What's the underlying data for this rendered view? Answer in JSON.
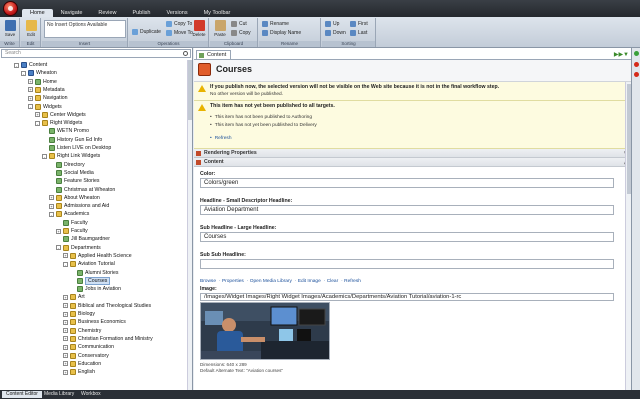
{
  "tabs": [
    "Home",
    "Navigate",
    "Review",
    "Publish",
    "Versions",
    "My Toolbar"
  ],
  "ribbon": {
    "save": "Save",
    "edit": "Edit",
    "insert_options": "No Insert Options Available",
    "duplicate": "Duplicate",
    "copy_to": "Copy To",
    "move_to": "Move To",
    "delete": "Delete",
    "paste": "Paste",
    "cut": "Cut",
    "copy": "Copy",
    "rename": "Rename",
    "display_name": "Display Name",
    "up": "Up",
    "down": "Down",
    "first": "First",
    "last": "Last",
    "groups": [
      "Write",
      "Edit",
      "Insert",
      "Operations",
      "Clipboard",
      "Rename",
      "Sorting"
    ]
  },
  "search": {
    "placeholder": "Search"
  },
  "tree": [
    {
      "label": "Content",
      "indent": 0,
      "icon": "db",
      "exp": "-"
    },
    {
      "label": "Wheaton",
      "indent": 1,
      "icon": "db",
      "exp": "-"
    },
    {
      "label": "Home",
      "indent": 2,
      "icon": "page",
      "exp": "+"
    },
    {
      "label": "Metadata",
      "indent": 2,
      "icon": "folder",
      "exp": "+"
    },
    {
      "label": "Navigation",
      "indent": 2,
      "icon": "folder",
      "exp": "+"
    },
    {
      "label": "Widgets",
      "indent": 2,
      "icon": "folder",
      "exp": "-"
    },
    {
      "label": "Center Widgets",
      "indent": 3,
      "icon": "folder",
      "exp": "+"
    },
    {
      "label": "Right Widgets",
      "indent": 3,
      "icon": "folder",
      "exp": "-"
    },
    {
      "label": "WETN Promo",
      "indent": 4,
      "icon": "page",
      "exp": ""
    },
    {
      "label": "History Gun Ed Info",
      "indent": 4,
      "icon": "page",
      "exp": ""
    },
    {
      "label": "Listen LIVE on Desktop",
      "indent": 4,
      "icon": "page",
      "exp": ""
    },
    {
      "label": "Right Link Widgets",
      "indent": 4,
      "icon": "folder",
      "exp": "-"
    },
    {
      "label": "Directory",
      "indent": 5,
      "icon": "page",
      "exp": ""
    },
    {
      "label": "Social Media",
      "indent": 5,
      "icon": "page",
      "exp": ""
    },
    {
      "label": "Feature Stories",
      "indent": 5,
      "icon": "page",
      "exp": ""
    },
    {
      "label": "Christmas at Wheaton",
      "indent": 5,
      "icon": "page",
      "exp": ""
    },
    {
      "label": "About Wheaton",
      "indent": 5,
      "icon": "folder",
      "exp": "+"
    },
    {
      "label": "Admissions and Aid",
      "indent": 5,
      "icon": "folder",
      "exp": "+"
    },
    {
      "label": "Academics",
      "indent": 5,
      "icon": "folder",
      "exp": "-"
    },
    {
      "label": "Faculty",
      "indent": 6,
      "icon": "page",
      "exp": ""
    },
    {
      "label": "Faculty",
      "indent": 6,
      "icon": "folder",
      "exp": "+"
    },
    {
      "label": "Jill Baumgardner",
      "indent": 6,
      "icon": "page",
      "exp": ""
    },
    {
      "label": "Departments",
      "indent": 6,
      "icon": "folder",
      "exp": "-"
    },
    {
      "label": "Applied Health Science",
      "indent": 7,
      "icon": "folder",
      "exp": "+"
    },
    {
      "label": "Aviation Tutorial",
      "indent": 7,
      "icon": "folder",
      "exp": "-"
    },
    {
      "label": "Alumni Stories",
      "indent": 8,
      "icon": "page",
      "exp": ""
    },
    {
      "label": "Courses",
      "indent": 8,
      "icon": "page",
      "exp": "",
      "selected": true
    },
    {
      "label": "Jobs in Aviation",
      "indent": 8,
      "icon": "page",
      "exp": ""
    },
    {
      "label": "Art",
      "indent": 7,
      "icon": "folder",
      "exp": "+"
    },
    {
      "label": "Biblical and Theological Studies",
      "indent": 7,
      "icon": "folder",
      "exp": "+"
    },
    {
      "label": "Biology",
      "indent": 7,
      "icon": "folder",
      "exp": "+"
    },
    {
      "label": "Business Economics",
      "indent": 7,
      "icon": "folder",
      "exp": "+"
    },
    {
      "label": "Chemistry",
      "indent": 7,
      "icon": "folder",
      "exp": "+"
    },
    {
      "label": "Christian Formation and Ministry",
      "indent": 7,
      "icon": "folder",
      "exp": "+"
    },
    {
      "label": "Communication",
      "indent": 7,
      "icon": "folder",
      "exp": "+"
    },
    {
      "label": "Conservatory",
      "indent": 7,
      "icon": "folder",
      "exp": "+"
    },
    {
      "label": "Education",
      "indent": 7,
      "icon": "folder",
      "exp": "+"
    },
    {
      "label": "English",
      "indent": 7,
      "icon": "folder",
      "exp": "+"
    }
  ],
  "content": {
    "tab_label": "Content",
    "title": "Courses",
    "warning1_title": "If you publish now, the selected version will not be visible on the Web site because it is not in the final workflow step.",
    "warning1_sub": "No other version will be published.",
    "warning2_title": "This item has not yet been published to all targets.",
    "bullets": [
      "This item has not been published to Authoring",
      "This item has not yet been published to Delivery"
    ],
    "refresh": "Refresh",
    "sections": {
      "rendering": "Rendering Properties",
      "content": "Content"
    },
    "fields": {
      "color_label": "Color:",
      "color_value": "Colors/green",
      "headline_label": "Headline - Small Descriptor Headline:",
      "headline_value": "Aviation Department",
      "sub_label": "Sub Headline - Large Headline:",
      "sub_value": "Courses",
      "subsub_label": "Sub Sub Headline:",
      "subsub_value": ""
    },
    "image_links": [
      "Browse",
      "Properties",
      "Open Media Library",
      "Edit Image",
      "Clear",
      "Refresh"
    ],
    "image_label": "Image:",
    "image_path": "/Images/Widget Images/Right Widget Images/Academics/Departments/Aviation Tutorial/aviation-1-rc",
    "image_dims": "Dimensions: 640 x 289",
    "image_alt": "Default Alternate Text: \"Aviation courses\""
  },
  "bottom_tabs": [
    "Content Editor",
    "Media Library",
    "Workbox"
  ],
  "colors": {
    "accent": "#e05c2a",
    "link": "#1a4f9a",
    "warning_bg": "#fdfbe0"
  }
}
